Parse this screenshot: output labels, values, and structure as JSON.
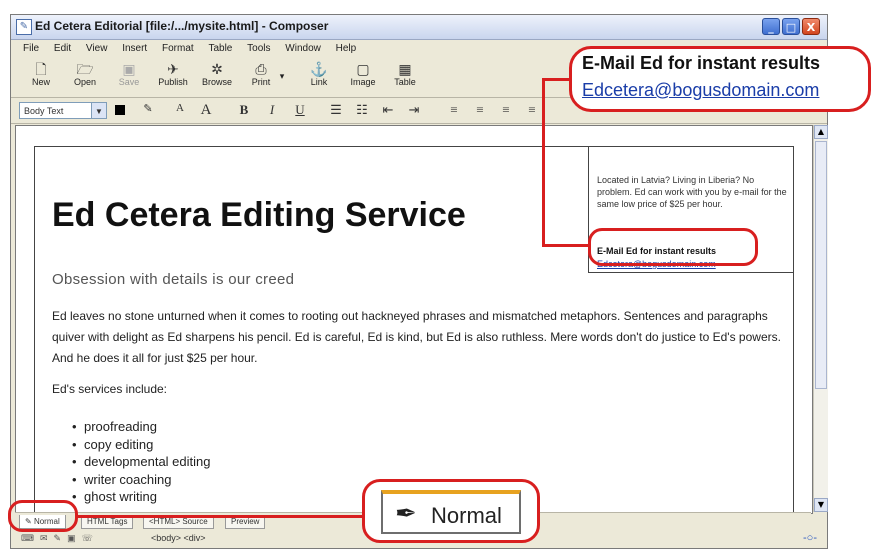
{
  "window": {
    "title": "Ed Cetera Editorial [file:/.../mysite.html] - Composer",
    "controls": {
      "minimize": "_",
      "maximize": "□",
      "close": "X"
    }
  },
  "menubar": {
    "items": [
      "File",
      "Edit",
      "View",
      "Insert",
      "Format",
      "Table",
      "Tools",
      "Window",
      "Help"
    ]
  },
  "toolbar": {
    "items": [
      {
        "label": "New",
        "icon": "new-document-icon",
        "glyph": "🗋"
      },
      {
        "label": "Open",
        "icon": "open-folder-icon",
        "glyph": "🗁"
      },
      {
        "label": "Save",
        "icon": "save-icon",
        "glyph": "▣"
      },
      {
        "label": "Publish",
        "icon": "publish-icon",
        "glyph": "✈"
      },
      {
        "label": "Browse",
        "icon": "browse-icon",
        "glyph": "✲"
      },
      {
        "label": "Print",
        "icon": "print-icon",
        "glyph": "⎙"
      },
      {
        "label": "Link",
        "icon": "link-icon",
        "glyph": "⚓"
      },
      {
        "label": "Image",
        "icon": "image-icon",
        "glyph": "▢"
      },
      {
        "label": "Table",
        "icon": "table-icon",
        "glyph": "▦"
      }
    ],
    "print_dropdown": "▾"
  },
  "formatbar": {
    "paragraph_style": "Body Text",
    "buttons": [
      "A",
      "A",
      "B",
      "I",
      "U",
      "☰",
      "☷",
      "⇤",
      "⇥",
      "≡",
      "≡",
      "≡",
      "≡"
    ]
  },
  "document": {
    "heading": "Ed Cetera Editing Service",
    "subheading": "Obsession with details is our creed",
    "paragraph": "Ed leaves no stone unturned when it comes to rooting out hackneyed phrases and mismatched metaphors. Sentences and paragraphs quiver with delight as Ed sharpens his pencil. Ed is careful, Ed is kind, but Ed is also ruthless. Mere words don't do justice to Ed's powers. And he does it all for just $25 per hour.",
    "services_intro": "Ed's services include:",
    "services": [
      "proofreading",
      "copy editing",
      "developmental editing",
      "writer coaching",
      "ghost writing"
    ],
    "sidebox": {
      "text": "Located in Latvia? Living in Liberia? No problem. Ed can work with you by e-mail for the same low price of $25 per hour.",
      "email_heading": "E-Mail Ed for instant results",
      "email_link": "Edcetera@bogusdomain.com"
    }
  },
  "modebar": {
    "tabs": [
      "Normal",
      "HTML Tags",
      "<HTML> Source",
      "Preview"
    ]
  },
  "statusbar": {
    "tags": "<body> <div>"
  },
  "callouts": {
    "email_heading": "E-Mail Ed for instant results",
    "email_link": "Edcetera@bogusdomain.com",
    "mode_label": "Normal"
  },
  "colors": {
    "callout": "#d81f1f",
    "link": "#1a3da8",
    "active_tab_accent": "#e7a220"
  }
}
